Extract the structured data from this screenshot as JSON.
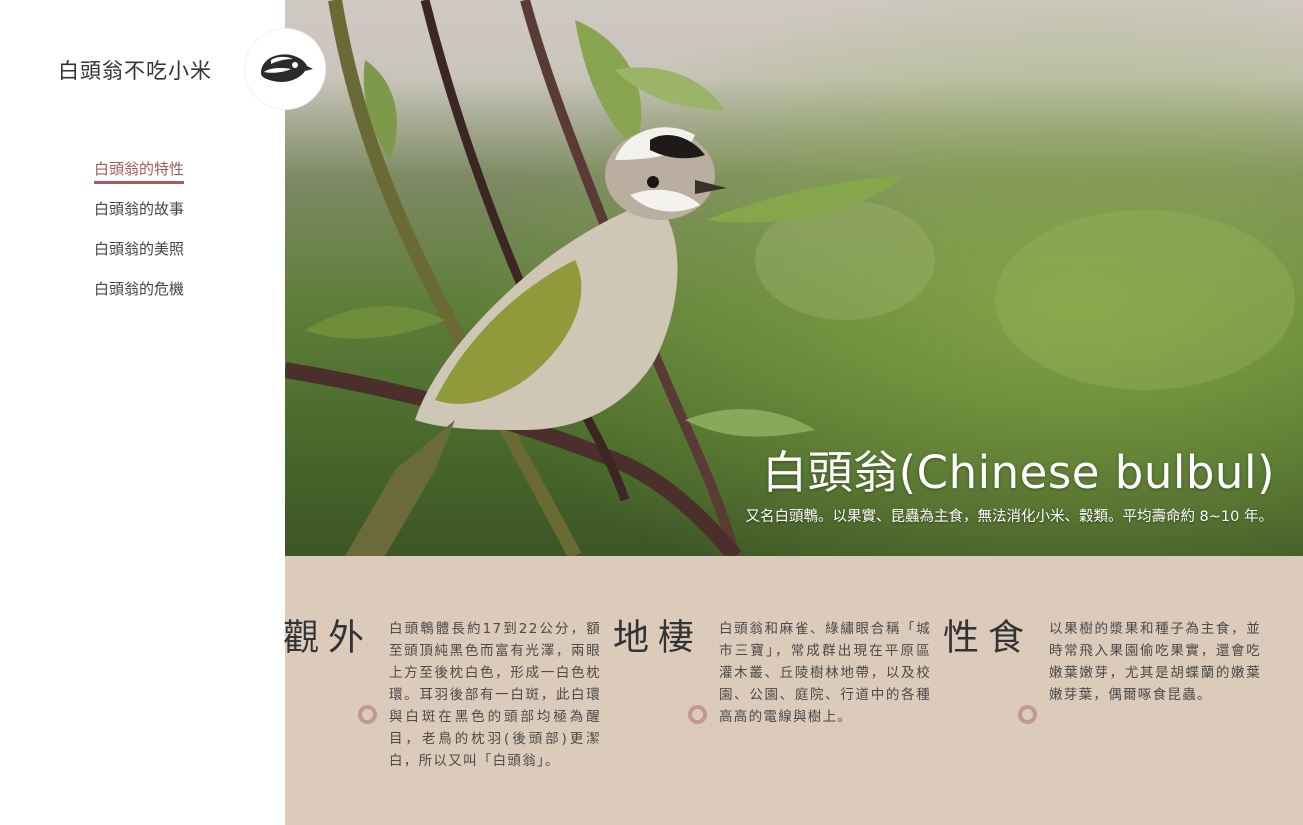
{
  "site": {
    "title": "白頭翁不吃小米",
    "logo_icon": "bulbul-head-icon"
  },
  "nav": {
    "items": [
      {
        "label": "白頭翁的特性",
        "active": true
      },
      {
        "label": "白頭翁的故事",
        "active": false
      },
      {
        "label": "白頭翁的美照",
        "active": false
      },
      {
        "label": "白頭翁的危機",
        "active": false
      }
    ]
  },
  "hero": {
    "title": "白頭翁(Chinese bulbul)",
    "subtitle": "又名白頭鵯。以果實、昆蟲為主食，無法消化小米、穀類。平均壽命約 8~10 年。"
  },
  "cards": [
    {
      "heading": "外觀",
      "text": "白頭鵯體長約17到22公分，額至頭頂純黑色而富有光澤，兩眼上方至後枕白色，形成一白色枕環。耳羽後部有一白斑，此白環與白斑在黑色的頭部均極為醒目，老鳥的枕羽(後頭部)更潔白，所以又叫「白頭翁」。"
    },
    {
      "heading": "棲地",
      "text": "白頭翁和麻雀、綠繡眼合稱「城市三寶」，常成群出現在平原區灌木叢、丘陵樹林地帶，以及校園、公園、庭院、行道中的各種高高的電線與樹上。"
    },
    {
      "heading": "食性",
      "text": "以果樹的漿果和種子為主食，並時常飛入果園偷吃果實，還會吃嫩葉嫩芽，尤其是胡蝶蘭的嫩葉嫩芽葉，偶爾啄食昆蟲。"
    }
  ],
  "colors": {
    "accent": "#a35c60",
    "band": "#dccbbb",
    "dot": "#c39697"
  }
}
